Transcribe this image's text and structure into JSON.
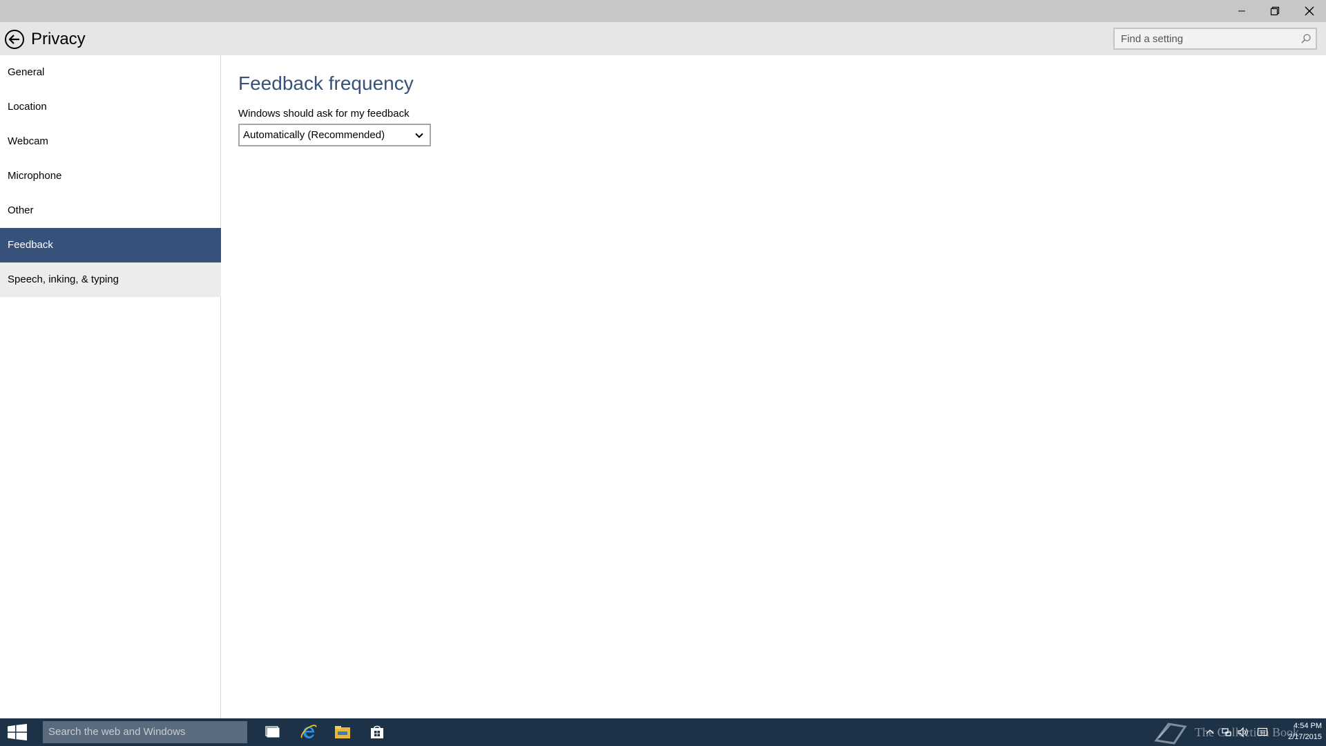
{
  "window": {
    "minimize_icon": "minimize-icon",
    "maximize_icon": "restore-icon",
    "close_icon": "close-icon"
  },
  "header": {
    "title": "Privacy",
    "back_icon": "back-arrow-icon",
    "search": {
      "placeholder": "Find a setting",
      "value": "",
      "icon": "search-icon"
    }
  },
  "sidebar": {
    "items": [
      {
        "label": "General"
      },
      {
        "label": "Location"
      },
      {
        "label": "Webcam"
      },
      {
        "label": "Microphone"
      },
      {
        "label": "Other"
      },
      {
        "label": "Feedback",
        "selected": true
      },
      {
        "label": "Speech, inking, & typing",
        "hovered": true
      }
    ]
  },
  "main": {
    "section_title": "Feedback frequency",
    "setting_label": "Windows should ask for my feedback",
    "dropdown": {
      "selected": "Automatically (Recommended)",
      "icon": "chevron-down-icon"
    }
  },
  "taskbar": {
    "start_icon": "windows-logo-icon",
    "search_placeholder": "Search the web and Windows",
    "pinned": [
      "task-view-icon",
      "internet-explorer-icon",
      "file-explorer-icon",
      "store-icon"
    ],
    "watermark": "The Collection Book",
    "tray": [
      "chevron-up-icon",
      "network-icon",
      "volume-icon",
      "action-center-icon"
    ],
    "time": "4:54 PM",
    "date": "2/17/2015"
  },
  "colors": {
    "accent": "#36527a",
    "taskbar": "#1d3147",
    "titlebar": "#c7c7c7",
    "header": "#e6e6e6"
  }
}
